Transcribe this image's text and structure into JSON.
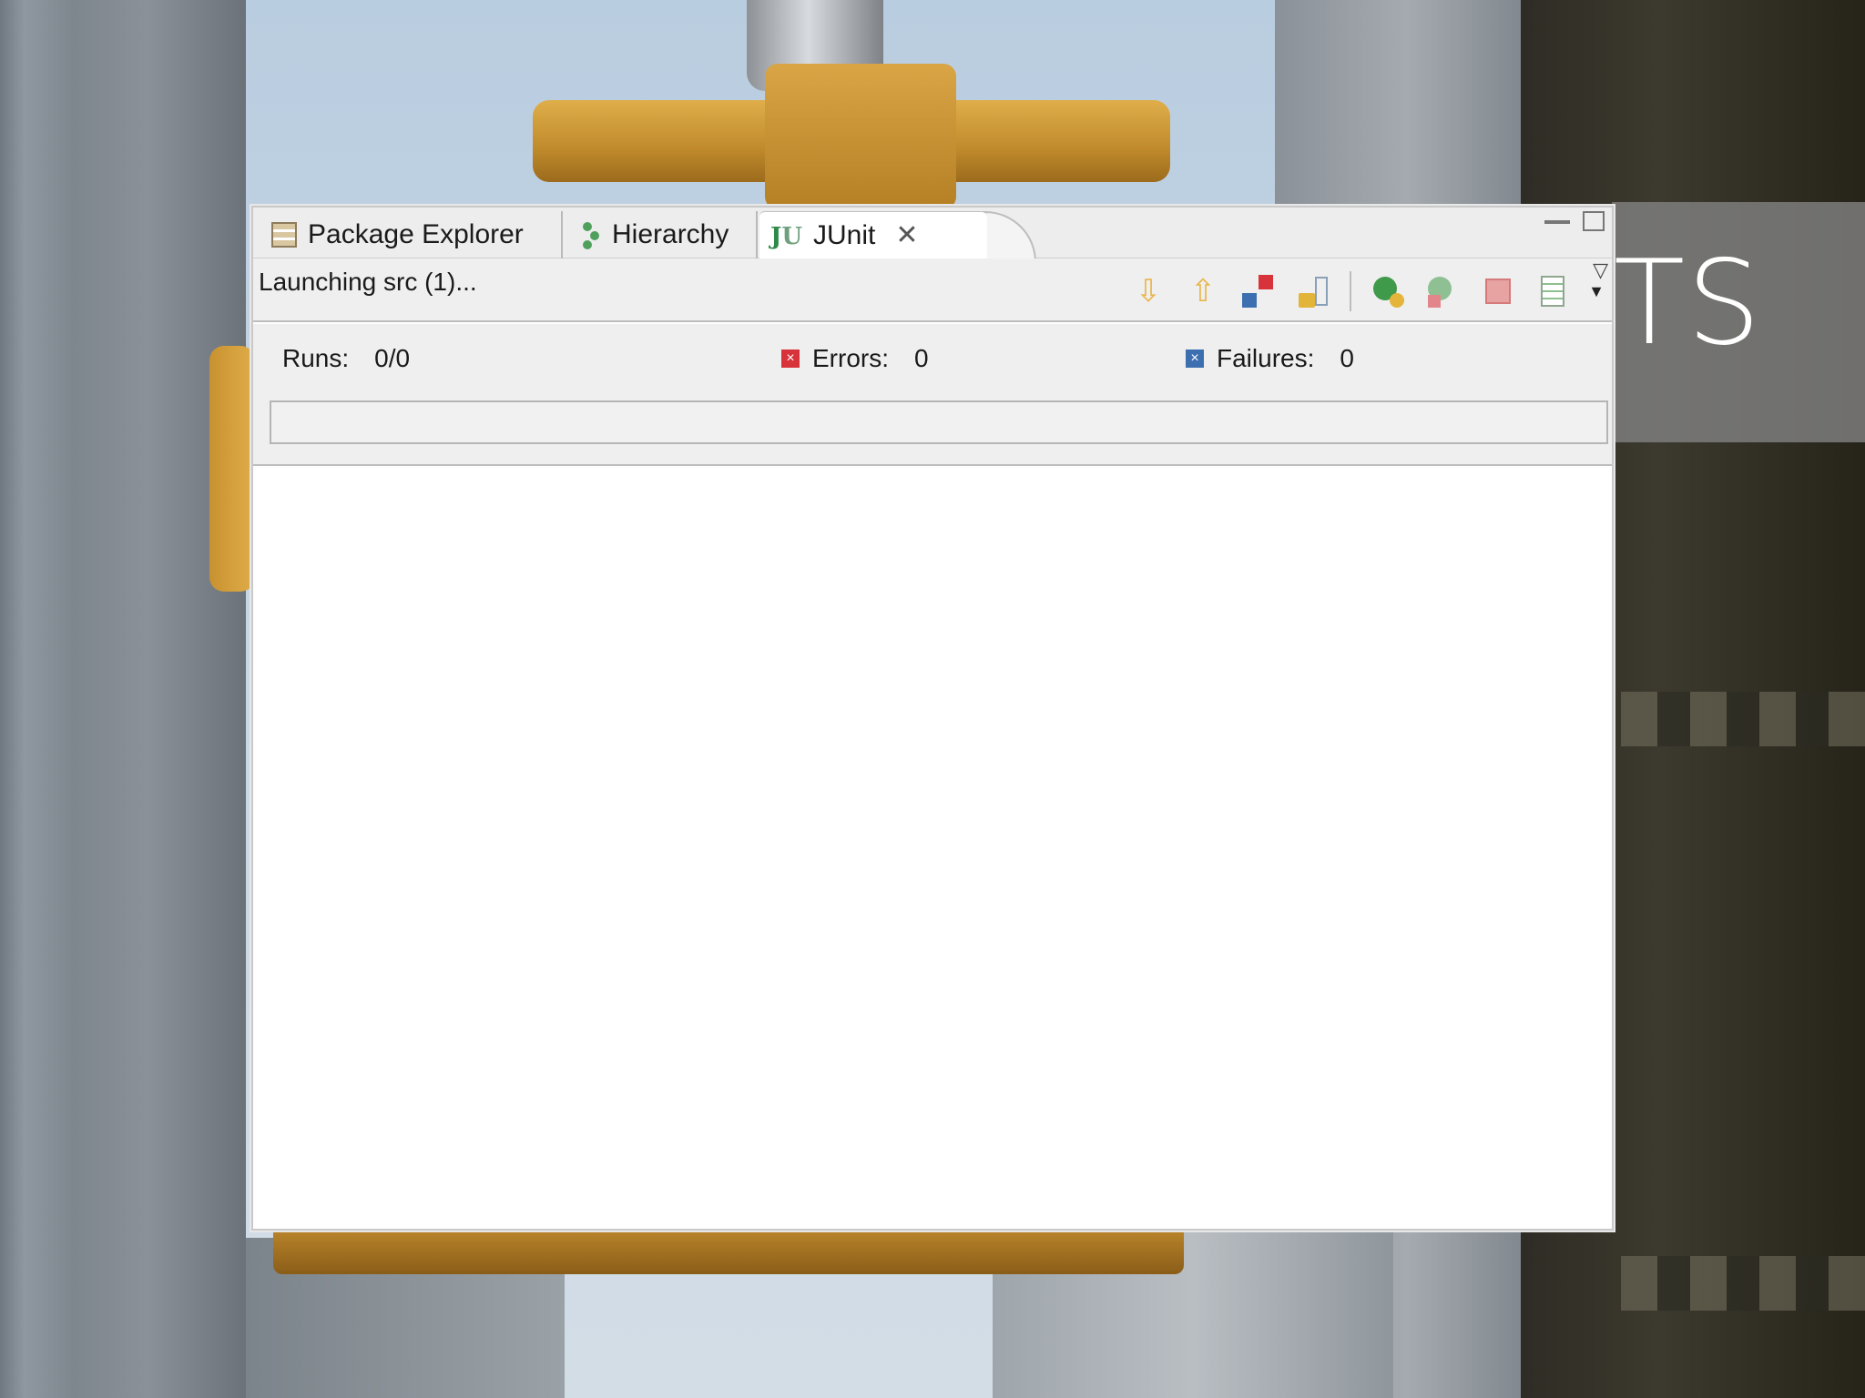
{
  "banner": {
    "text": "TS"
  },
  "tabs": {
    "package_explorer": "Package Explorer",
    "hierarchy": "Hierarchy",
    "junit": "JUnit"
  },
  "toolbar": {
    "status": "Launching src (1)..."
  },
  "counters": {
    "runs_label": "Runs:",
    "runs_value": "0/0",
    "errors_label": "Errors:",
    "errors_value": "0",
    "failures_label": "Failures:",
    "failures_value": "0"
  },
  "progress": {
    "fraction": 0
  },
  "icons": {
    "package_explorer": "package-explorer-icon",
    "hierarchy": "hierarchy-icon",
    "junit": "junit-icon",
    "close": "close-icon",
    "next_failure": "arrow-down-icon",
    "previous_failure": "arrow-up-icon",
    "show_failures_only": "failures-only-icon",
    "scroll_lock": "scroll-lock-icon",
    "rerun": "rerun-icon",
    "rerun_failed_first": "rerun-failed-first-icon",
    "stop": "stop-icon",
    "history": "history-icon",
    "view_menu": "view-menu-icon"
  },
  "colors": {
    "error": "#d8323a",
    "failure": "#3c6fb0",
    "junit_green": "#2e8a4a",
    "banner_bg": "#808080"
  }
}
